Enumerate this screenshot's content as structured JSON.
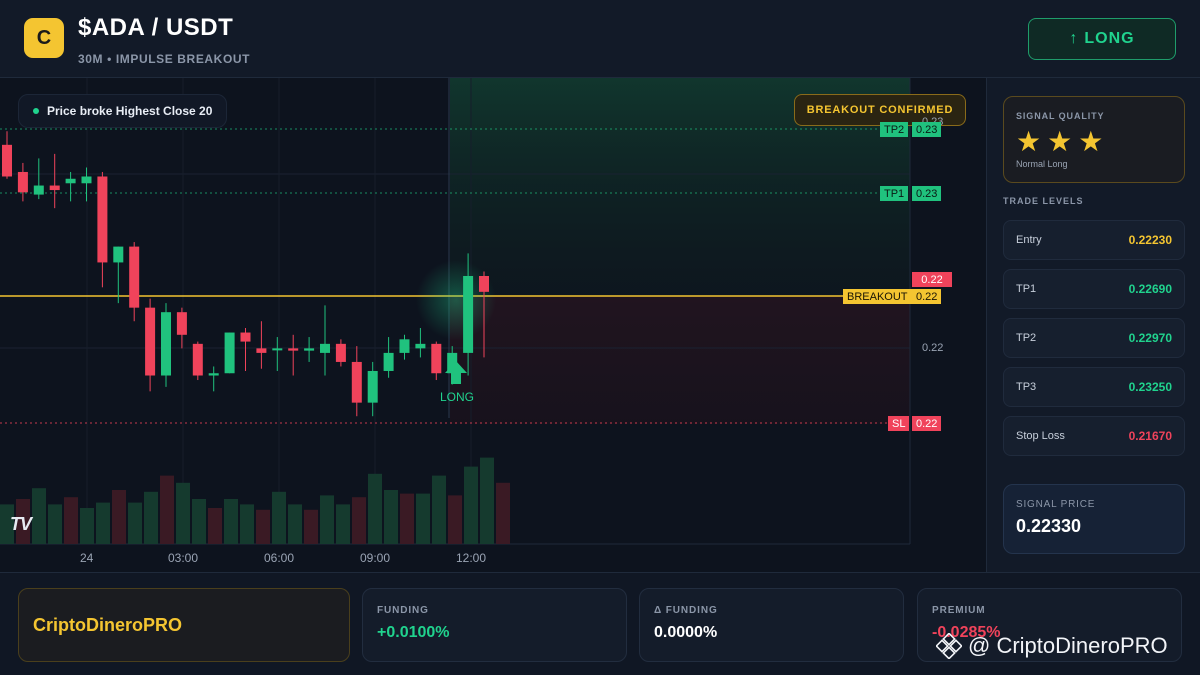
{
  "header": {
    "coin_letter": "C",
    "title": "$ADA / USDT",
    "subtitle": "30M • IMPULSE BREAKOUT",
    "long_button": "LONG",
    "long_arrow": "↑"
  },
  "chart": {
    "legend": "Price broke Highest Close 20",
    "breakout_badge": "BREAKOUT CONFIRMED",
    "tags": {
      "tp2_label": "TP2",
      "tp2_value": "0.23",
      "tp1_label": "TP1",
      "tp1_value": "0.23",
      "current_value": "0.22",
      "breakout_label": "BREAKOUT",
      "breakout_value": "0.22",
      "sl_label": "SL",
      "sl_value": "0.22"
    },
    "axis_labels": {
      "top": "0.23",
      "mid": "0.22"
    },
    "time_labels": [
      "24",
      "03:00",
      "06:00",
      "09:00",
      "12:00"
    ],
    "long_marker": "LONG",
    "tv_logo": "TV"
  },
  "chart_data": {
    "type": "candlestick",
    "interval": "30M",
    "y_axis_ticks": [
      "0.23",
      "0.22"
    ],
    "x_ticks": [
      "24",
      "03:00",
      "06:00",
      "09:00",
      "12:00"
    ],
    "levels": {
      "entry": 0.2223,
      "tp1": 0.2269,
      "tp2": 0.2297,
      "tp3": 0.2325,
      "stop_loss": 0.2167,
      "breakout": 0.2223
    },
    "candles": [
      {
        "o": 0.229,
        "h": 0.2296,
        "l": 0.2275,
        "c": 0.2276
      },
      {
        "o": 0.2278,
        "h": 0.2282,
        "l": 0.2265,
        "c": 0.2269
      },
      {
        "o": 0.2268,
        "h": 0.2284,
        "l": 0.2266,
        "c": 0.2272
      },
      {
        "o": 0.2272,
        "h": 0.2286,
        "l": 0.2262,
        "c": 0.227
      },
      {
        "o": 0.2273,
        "h": 0.2278,
        "l": 0.2265,
        "c": 0.2275
      },
      {
        "o": 0.2273,
        "h": 0.228,
        "l": 0.2265,
        "c": 0.2276
      },
      {
        "o": 0.2276,
        "h": 0.2278,
        "l": 0.2227,
        "c": 0.2238
      },
      {
        "o": 0.2238,
        "h": 0.2245,
        "l": 0.222,
        "c": 0.2245
      },
      {
        "o": 0.2245,
        "h": 0.2247,
        "l": 0.2212,
        "c": 0.2218
      },
      {
        "o": 0.2218,
        "h": 0.2222,
        "l": 0.2181,
        "c": 0.2188
      },
      {
        "o": 0.2188,
        "h": 0.222,
        "l": 0.2183,
        "c": 0.2216
      },
      {
        "o": 0.2216,
        "h": 0.2218,
        "l": 0.22,
        "c": 0.2206
      },
      {
        "o": 0.2202,
        "h": 0.2203,
        "l": 0.2186,
        "c": 0.2188
      },
      {
        "o": 0.2188,
        "h": 0.2192,
        "l": 0.2181,
        "c": 0.2189
      },
      {
        "o": 0.2189,
        "h": 0.2207,
        "l": 0.2189,
        "c": 0.2207
      },
      {
        "o": 0.2207,
        "h": 0.2209,
        "l": 0.219,
        "c": 0.2203
      },
      {
        "o": 0.22,
        "h": 0.2212,
        "l": 0.2191,
        "c": 0.2198
      },
      {
        "o": 0.22,
        "h": 0.2205,
        "l": 0.219,
        "c": 0.22
      },
      {
        "o": 0.22,
        "h": 0.2206,
        "l": 0.2188,
        "c": 0.2199
      },
      {
        "o": 0.2199,
        "h": 0.2205,
        "l": 0.2194,
        "c": 0.22
      },
      {
        "o": 0.2198,
        "h": 0.2219,
        "l": 0.2188,
        "c": 0.2202
      },
      {
        "o": 0.2202,
        "h": 0.2204,
        "l": 0.2192,
        "c": 0.2194
      },
      {
        "o": 0.2194,
        "h": 0.2201,
        "l": 0.217,
        "c": 0.2176
      },
      {
        "o": 0.2176,
        "h": 0.2194,
        "l": 0.217,
        "c": 0.219
      },
      {
        "o": 0.219,
        "h": 0.2205,
        "l": 0.2187,
        "c": 0.2198
      },
      {
        "o": 0.2198,
        "h": 0.2206,
        "l": 0.2195,
        "c": 0.2204
      },
      {
        "o": 0.22,
        "h": 0.2209,
        "l": 0.2196,
        "c": 0.2202
      },
      {
        "o": 0.2202,
        "h": 0.2203,
        "l": 0.2186,
        "c": 0.2189
      },
      {
        "o": 0.2189,
        "h": 0.2201,
        "l": 0.2184,
        "c": 0.2198
      },
      {
        "o": 0.2198,
        "h": 0.2242,
        "l": 0.2188,
        "c": 0.2232
      },
      {
        "o": 0.2232,
        "h": 0.2234,
        "l": 0.2196,
        "c": 0.2225
      }
    ],
    "volumes": [
      22,
      25,
      31,
      22,
      26,
      20,
      23,
      30,
      23,
      29,
      38,
      34,
      25,
      20,
      25,
      22,
      19,
      29,
      22,
      19,
      27,
      22,
      26,
      39,
      30,
      28,
      28,
      38,
      27,
      43,
      48,
      34
    ]
  },
  "panel": {
    "quality_label": "SIGNAL QUALITY",
    "stars": 3,
    "quality_sub": "Normal Long",
    "trade_levels_label": "TRADE LEVELS",
    "levels": [
      {
        "name": "Entry",
        "value": "0.22230",
        "color": "#f4c531"
      },
      {
        "name": "TP1",
        "value": "0.22690",
        "color": "#20d38e"
      },
      {
        "name": "TP2",
        "value": "0.22970",
        "color": "#20d38e"
      },
      {
        "name": "TP3",
        "value": "0.23250",
        "color": "#20d38e"
      },
      {
        "name": "Stop Loss",
        "value": "0.21670",
        "color": "#f0435b"
      }
    ],
    "signal_price_label": "SIGNAL PRICE",
    "signal_price": "0.22330"
  },
  "bottom": {
    "brand": "CriptoDineroPRO",
    "funding_label": "FUNDING",
    "funding_value": "+0.0100%",
    "delta_funding_label": "Δ FUNDING",
    "delta_funding_value": "0.0000%",
    "premium_label": "PREMIUM",
    "premium_value": "-0.0285%",
    "watermark": "@ CriptoDineroPRO"
  },
  "colors": {
    "up": "#20c27e",
    "down": "#f0435b",
    "accent": "#f4c531",
    "background": "#0f1522"
  }
}
